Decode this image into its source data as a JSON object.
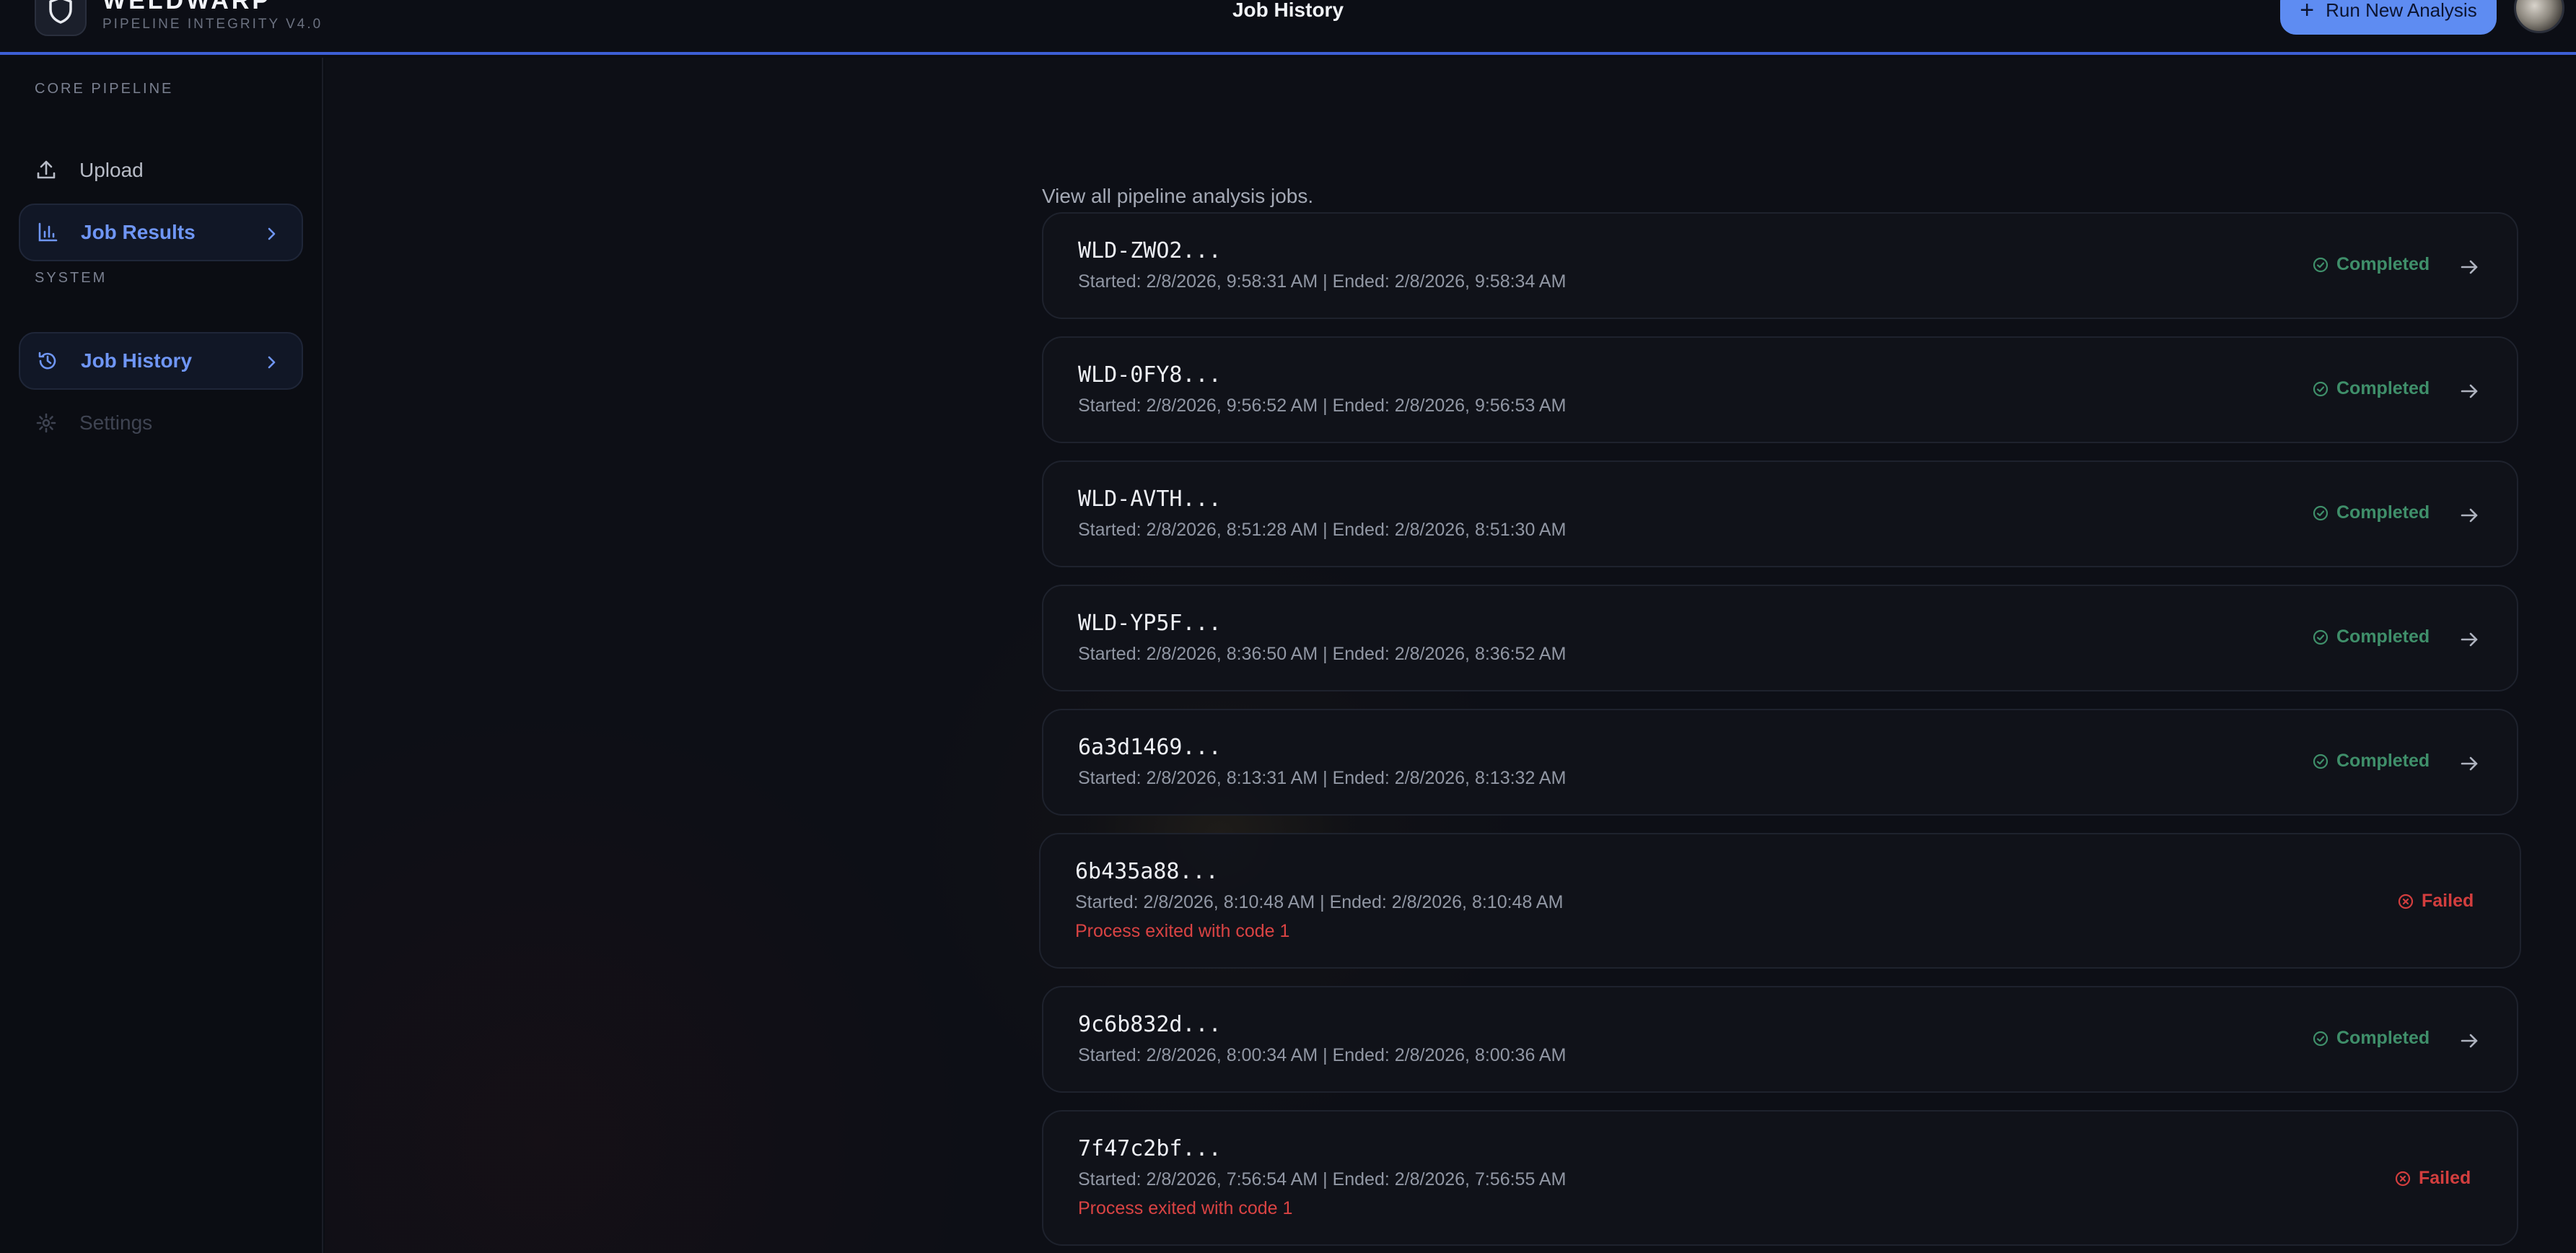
{
  "app": {
    "brand_name": "WELDWARP",
    "brand_sub": "PIPELINE INTEGRITY V4.0",
    "page_title": "Job History",
    "run_button_label": "Run New Analysis",
    "accent_color": "#5e8cf2"
  },
  "sidebar": {
    "section_core": "CORE PIPELINE",
    "section_system": "SYSTEM",
    "items": [
      {
        "label": "Upload",
        "icon": "upload-icon",
        "state": "normal"
      },
      {
        "label": "Job Results",
        "icon": "bar-chart-icon",
        "state": "active"
      },
      {
        "label": "Job History",
        "icon": "history-icon",
        "state": "active"
      },
      {
        "label": "Settings",
        "icon": "gear-icon",
        "state": "disabled"
      }
    ]
  },
  "main": {
    "subtitle": "View all pipeline analysis jobs.",
    "jobs": [
      {
        "id": "WLD-ZWO2...",
        "times": "Started: 2/8/2026, 9:58:31 AM | Ended: 2/8/2026, 9:58:34 AM",
        "status": "Completed",
        "error": ""
      },
      {
        "id": "WLD-0FY8...",
        "times": "Started: 2/8/2026, 9:56:52 AM | Ended: 2/8/2026, 9:56:53 AM",
        "status": "Completed",
        "error": ""
      },
      {
        "id": "WLD-AVTH...",
        "times": "Started: 2/8/2026, 8:51:28 AM | Ended: 2/8/2026, 8:51:30 AM",
        "status": "Completed",
        "error": ""
      },
      {
        "id": "WLD-YP5F...",
        "times": "Started: 2/8/2026, 8:36:50 AM | Ended: 2/8/2026, 8:36:52 AM",
        "status": "Completed",
        "error": ""
      },
      {
        "id": "6a3d1469...",
        "times": "Started: 2/8/2026, 8:13:31 AM | Ended: 2/8/2026, 8:13:32 AM",
        "status": "Completed",
        "error": ""
      },
      {
        "id": "6b435a88...",
        "times": "Started: 2/8/2026, 8:10:48 AM | Ended: 2/8/2026, 8:10:48 AM",
        "status": "Failed",
        "error": "Process exited with code 1"
      },
      {
        "id": "9c6b832d...",
        "times": "Started: 2/8/2026, 8:00:34 AM | Ended: 2/8/2026, 8:00:36 AM",
        "status": "Completed",
        "error": ""
      },
      {
        "id": "7f47c2bf...",
        "times": "Started: 2/8/2026, 7:56:54 AM | Ended: 2/8/2026, 7:56:55 AM",
        "status": "Failed",
        "error": "Process exited with code 1"
      }
    ]
  }
}
